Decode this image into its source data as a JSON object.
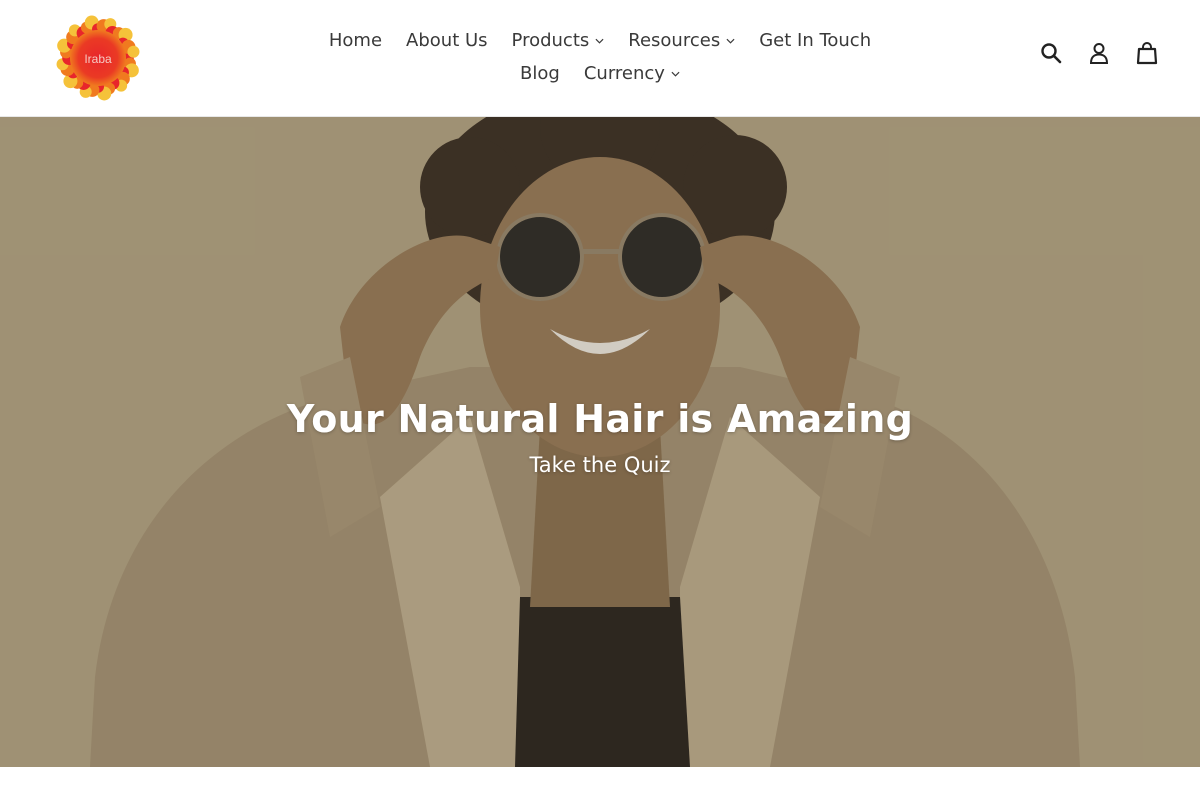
{
  "brand": {
    "logo_text": "Iraba",
    "logo_colors": [
      "#e8262b",
      "#f07a1f",
      "#f5c23a"
    ]
  },
  "nav": {
    "row1": [
      {
        "label": "Home",
        "dropdown": false
      },
      {
        "label": "About Us",
        "dropdown": false
      },
      {
        "label": "Products",
        "dropdown": true
      },
      {
        "label": "Resources",
        "dropdown": true
      },
      {
        "label": "Get In Touch",
        "dropdown": false
      }
    ],
    "row2": [
      {
        "label": "Blog",
        "dropdown": false
      },
      {
        "label": "Currency",
        "dropdown": true
      }
    ]
  },
  "header_icons": [
    "search-icon",
    "account-icon",
    "cart-icon"
  ],
  "hero": {
    "title": "Your Natural Hair is Amazing",
    "subtitle": "Take the Quiz",
    "tint": "#b3a684"
  }
}
